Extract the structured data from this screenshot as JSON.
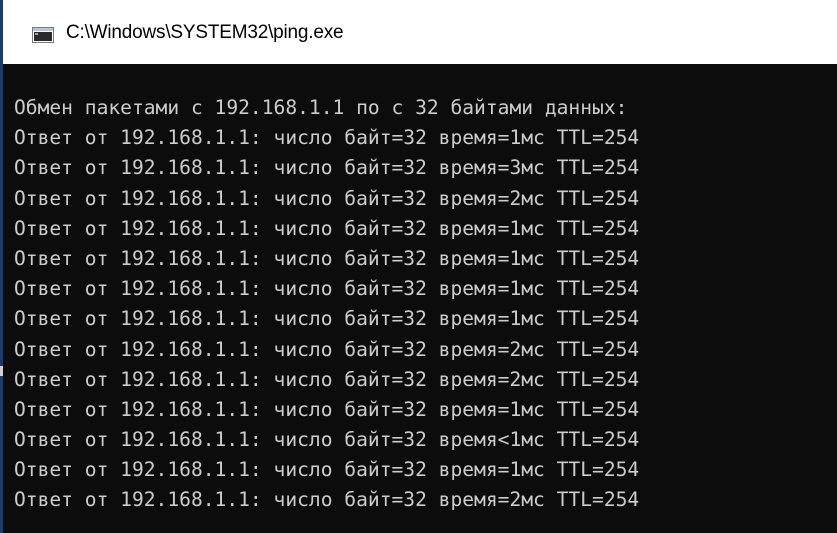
{
  "window": {
    "title": "C:\\Windows\\SYSTEM32\\ping.exe",
    "icon": "console-window-icon"
  },
  "colors": {
    "console_background": "#0c0c0c",
    "console_text": "#cccccc",
    "titlebar_background": "#ffffff",
    "window_border": "#1a3a6e"
  },
  "console": {
    "lines": [
      "Обмен пакетами с 192.168.1.1 по с 32 байтами данных:",
      "Ответ от 192.168.1.1: число байт=32 время=1мс TTL=254",
      "Ответ от 192.168.1.1: число байт=32 время=3мс TTL=254",
      "Ответ от 192.168.1.1: число байт=32 время=2мс TTL=254",
      "Ответ от 192.168.1.1: число байт=32 время=1мс TTL=254",
      "Ответ от 192.168.1.1: число байт=32 время=1мс TTL=254",
      "Ответ от 192.168.1.1: число байт=32 время=1мс TTL=254",
      "Ответ от 192.168.1.1: число байт=32 время=1мс TTL=254",
      "Ответ от 192.168.1.1: число байт=32 время=2мс TTL=254",
      "Ответ от 192.168.1.1: число байт=32 время=2мс TTL=254",
      "Ответ от 192.168.1.1: число байт=32 время=1мс TTL=254",
      "Ответ от 192.168.1.1: число байт=32 время<1мс TTL=254",
      "Ответ от 192.168.1.1: число байт=32 время=1мс TTL=254",
      "Ответ от 192.168.1.1: число байт=32 время=2мс TTL=254"
    ]
  }
}
